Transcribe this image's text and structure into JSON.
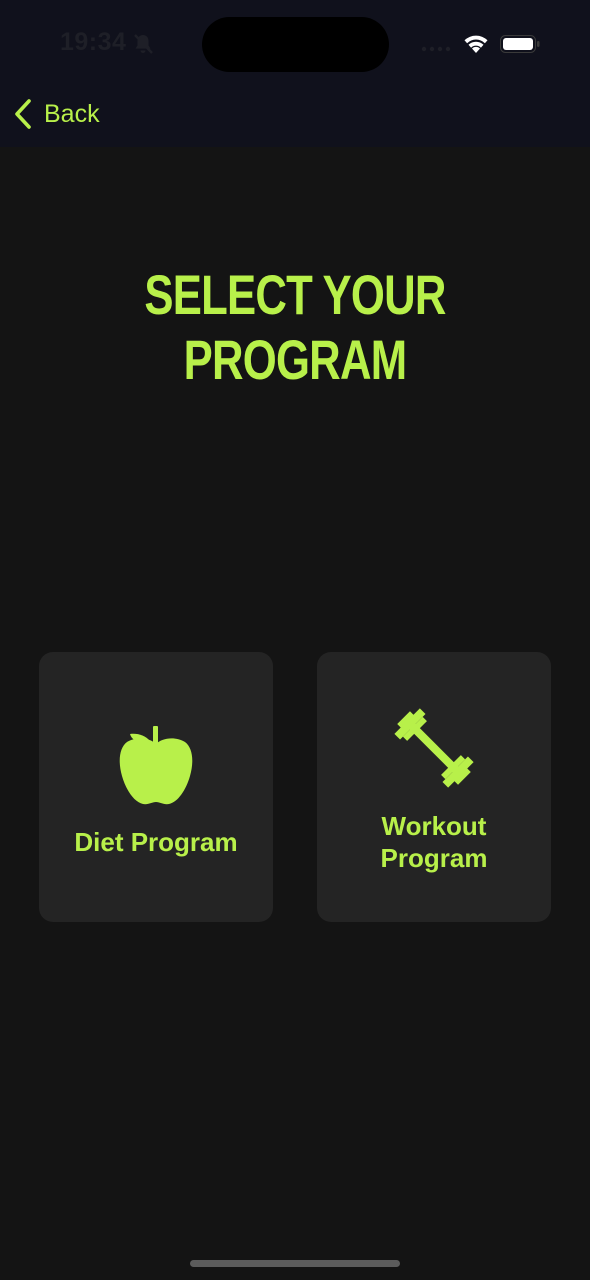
{
  "status_bar": {
    "time": "19:34"
  },
  "nav": {
    "back_label": "Back"
  },
  "title": "SELECT YOUR PROGRAM",
  "cards": [
    {
      "label": "Diet Program",
      "icon": "apple-icon"
    },
    {
      "label": "Workout\nProgram",
      "icon": "dumbbell-icon"
    }
  ],
  "colors": {
    "accent": "#b8f04a",
    "background": "#141414",
    "card": "#242424",
    "nav_bg": "#10111c"
  }
}
